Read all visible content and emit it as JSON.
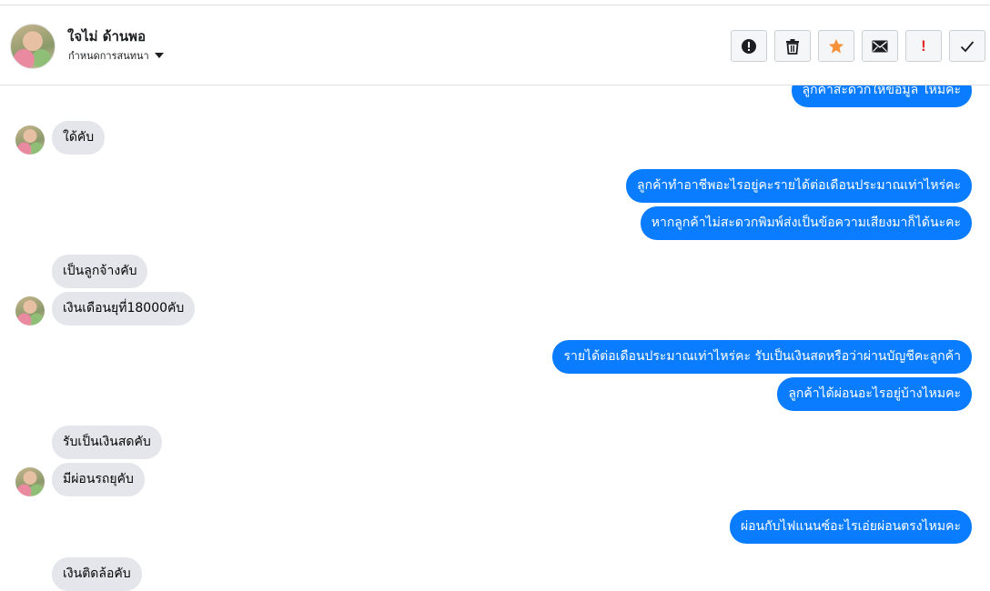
{
  "header": {
    "contact_name": "ใจไม่ ด้านพอ",
    "subtitle": "กำหนดการสนทนา",
    "actions": [
      {
        "name": "report-button",
        "icon": "alert-circle-icon"
      },
      {
        "name": "delete-button",
        "icon": "trash-icon"
      },
      {
        "name": "star-button",
        "icon": "star-icon",
        "color": "#f7923b"
      },
      {
        "name": "mark-unread-button",
        "icon": "envelope-icon"
      },
      {
        "name": "spam-button",
        "icon": "exclamation-icon",
        "label": "!",
        "color": "#e02b2b"
      },
      {
        "name": "done-button",
        "icon": "checkmark-icon"
      }
    ]
  },
  "colors": {
    "outgoing_bubble": "#0a7cff",
    "incoming_bubble": "#e4e6eb"
  },
  "messages": {
    "m0": "ลูกค้าสะดวกให้ข้อมูล ไหมคะ",
    "m1": "ใด้คับ",
    "m2": "ลูกค้าทำอาชีพอะไรอยู่คะรายได้ต่อเดือนประมาณเท่าไหร่คะ",
    "m3": "หากลูกค้าไม่สะดวกพิมพ์ส่งเป็นข้อความเสียงมาก็ได้นะคะ",
    "m4": "เป็นลูกจ้างคับ",
    "m5": "เงินเดือนยุที่18000คับ",
    "m6": "รายได้ต่อเดือนประมาณเท่าไหร่คะ รับเป็นเงินสดหรือว่าผ่านบัญชีคะลูกค้า",
    "m7": "ลูกค้าได้ผ่อนอะไรอยู่บ้างไหมคะ",
    "m8": "รับเป็นเงินสดคับ",
    "m9": "มีผ่อนรถยุคับ",
    "m10": "ผ่อนกับไฟแนนซ์อะไรเอ่ยผ่อนตรงไหมคะ",
    "m11": "เงินติดล้อคับ"
  }
}
